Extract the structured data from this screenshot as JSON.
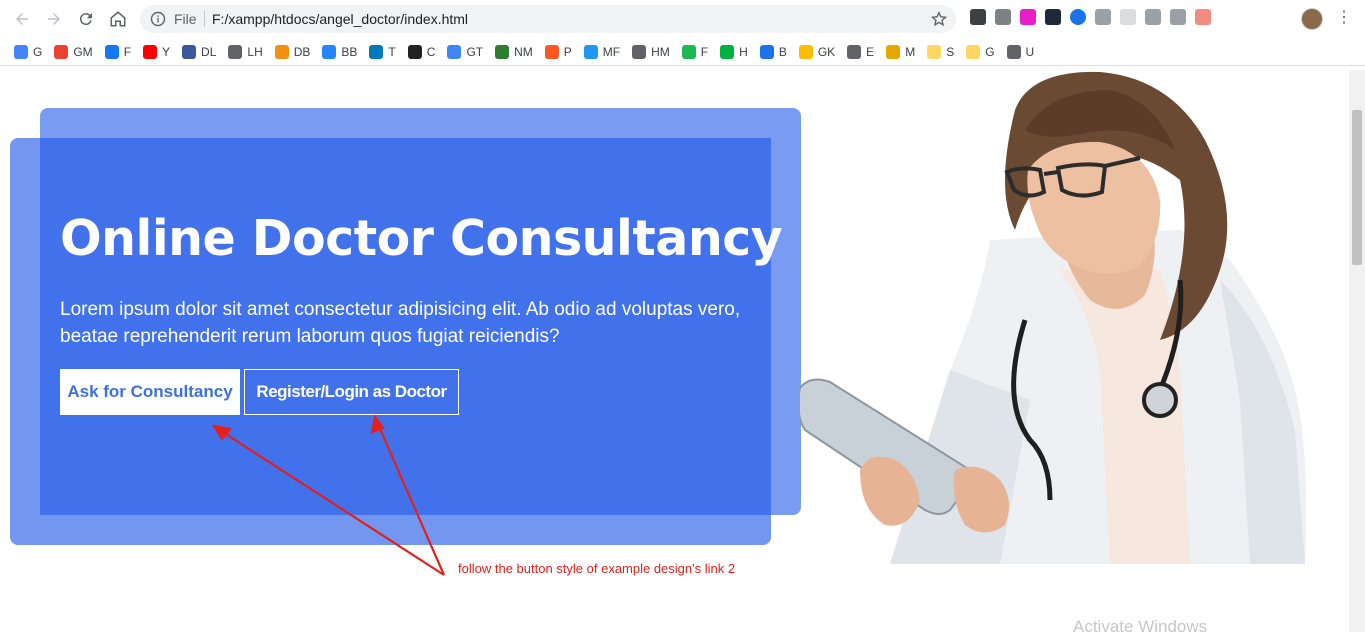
{
  "browser": {
    "file_label": "File",
    "url": "F:/xampp/htdocs/angel_doctor/index.html",
    "bookmarks": [
      {
        "label": "G",
        "color": "#4285f4"
      },
      {
        "label": "GM",
        "color": "#ea4335"
      },
      {
        "label": "F",
        "color": "#1877f2"
      },
      {
        "label": "Y",
        "color": "#ff0000"
      },
      {
        "label": "DL",
        "color": "#3b5998"
      },
      {
        "label": "LH",
        "color": "#5f6368"
      },
      {
        "label": "DB",
        "color": "#f29111"
      },
      {
        "label": "BB",
        "color": "#2684ff"
      },
      {
        "label": "T",
        "color": "#0079bf"
      },
      {
        "label": "C",
        "color": "#222222"
      },
      {
        "label": "GT",
        "color": "#4285f4"
      },
      {
        "label": "NM",
        "color": "#2e7d32"
      },
      {
        "label": "P",
        "color": "#ff5722"
      },
      {
        "label": "MF",
        "color": "#2196f3"
      },
      {
        "label": "HM",
        "color": "#5f6368"
      },
      {
        "label": "F",
        "color": "#1db954"
      },
      {
        "label": "H",
        "color": "#00b140"
      },
      {
        "label": "B",
        "color": "#1a73e8"
      },
      {
        "label": "GK",
        "color": "#fbbc04"
      },
      {
        "label": "E",
        "color": "#5f6368"
      },
      {
        "label": "M",
        "color": "#e6a800"
      },
      {
        "label": "S",
        "color": "#fdd663"
      },
      {
        "label": "G",
        "color": "#fdd663"
      },
      {
        "label": "U",
        "color": "#5f6368"
      }
    ]
  },
  "hero": {
    "title": "Online Doctor Consultancy",
    "text": "Lorem ipsum dolor sit amet consectetur adipisicing elit. Ab odio ad voluptas vero, beatae reprehenderit rerum laborum quos fugiat reiciendis?",
    "primary_button": "Ask for Consultancy",
    "secondary_button": "Register/Login as Doctor",
    "colors": {
      "accent": "#4171eb",
      "light": "#7a9bf2"
    }
  },
  "annotation": "follow the button style of example design's link 2",
  "watermark": "Activate Windows"
}
